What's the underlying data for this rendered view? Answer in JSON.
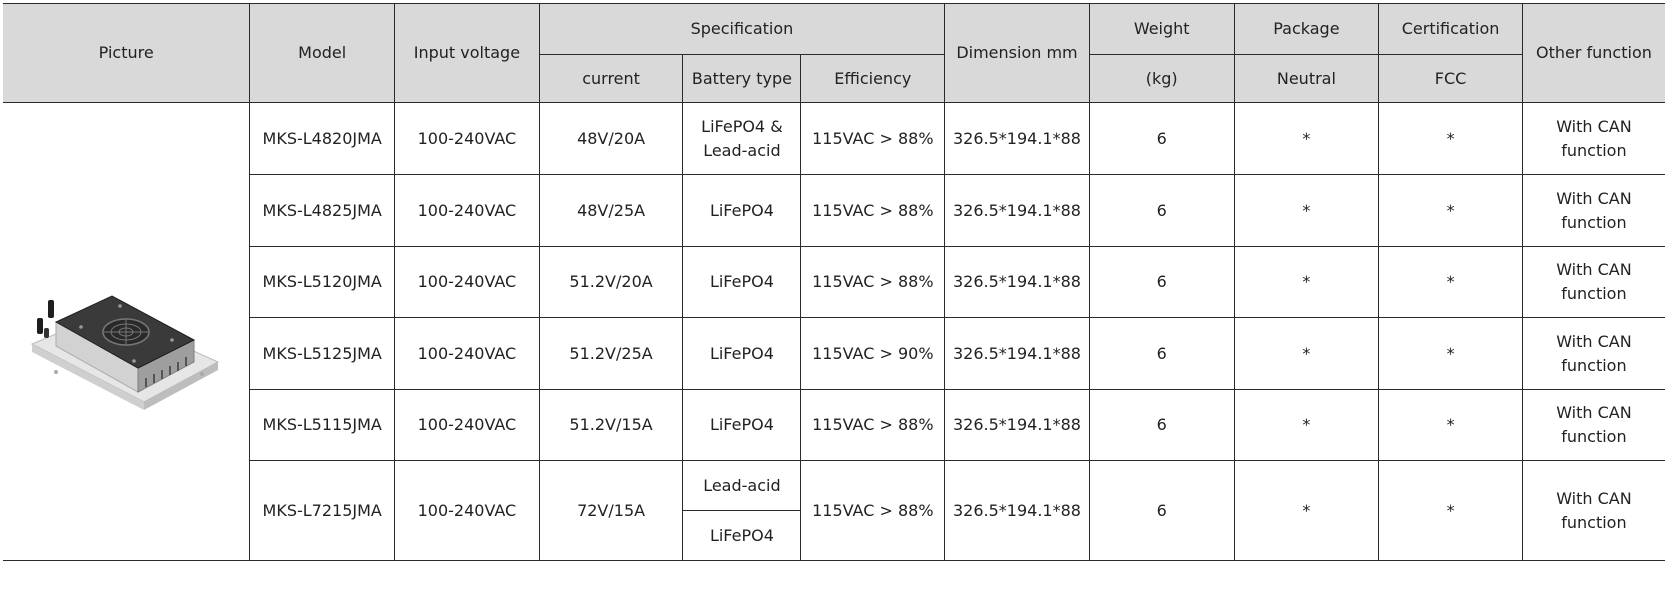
{
  "header": {
    "picture": "Picture",
    "model": "Model",
    "input_voltage": "Input voltage",
    "specification": "Specification",
    "current": "current",
    "battery_type": "Battery type",
    "efficiency": "Efficiency",
    "dimension": "Dimension mm",
    "weight": "Weight",
    "weight_unit": "(kg)",
    "package": "Package",
    "package_sub": "Neutral",
    "certification": "Certification",
    "certification_sub": "FCC",
    "other_function": "Other function"
  },
  "rows": [
    {
      "model": "MKS-L4820JMA",
      "input": "100-240VAC",
      "current": "48V/20A",
      "battery_1": "LiFePO4 &",
      "battery_2": "Lead-acid",
      "efficiency": "115VAC > 88%",
      "dimension": "326.5*194.1*88",
      "weight": "6",
      "package": "*",
      "certification": "*",
      "other_1": "With CAN",
      "other_2": "function"
    },
    {
      "model": "MKS-L4825JMA",
      "input": "100-240VAC",
      "current": "48V/25A",
      "battery": "LiFePO4",
      "efficiency": "115VAC > 88%",
      "dimension": "326.5*194.1*88",
      "weight": "6",
      "package": "*",
      "certification": "*",
      "other_1": "With CAN",
      "other_2": "function"
    },
    {
      "model": "MKS-L5120JMA",
      "input": "100-240VAC",
      "current": "51.2V/20A",
      "battery": "LiFePO4",
      "efficiency": "115VAC > 88%",
      "dimension": "326.5*194.1*88",
      "weight": "6",
      "package": "*",
      "certification": "*",
      "other_1": "With CAN",
      "other_2": "function"
    },
    {
      "model": "MKS-L5125JMA",
      "input": "100-240VAC",
      "current": "51.2V/25A",
      "battery": "LiFePO4",
      "efficiency": "115VAC > 90%",
      "dimension": "326.5*194.1*88",
      "weight": "6",
      "package": "*",
      "certification": "*",
      "other_1": "With CAN",
      "other_2": "function"
    },
    {
      "model": "MKS-L5115JMA",
      "input": "100-240VAC",
      "current": "51.2V/15A",
      "battery": "LiFePO4",
      "efficiency": "115VAC > 88%",
      "dimension": "326.5*194.1*88",
      "weight": "6",
      "package": "*",
      "certification": "*",
      "other_1": "With CAN",
      "other_2": "function"
    },
    {
      "model": "MKS-L7215JMA",
      "input": "100-240VAC",
      "current": "72V/15A",
      "battery_a": "Lead-acid",
      "battery_b": "LiFePO4",
      "efficiency": "115VAC > 88%",
      "dimension": "326.5*194.1*88",
      "weight": "6",
      "package": "*",
      "certification": "*",
      "other_1": "With CAN",
      "other_2": "function"
    }
  ],
  "colors": {
    "header_bg": "#d9d9d9",
    "border": "#2a2a2a",
    "text": "#222222"
  },
  "icons": {
    "product": "charger-product-image"
  }
}
